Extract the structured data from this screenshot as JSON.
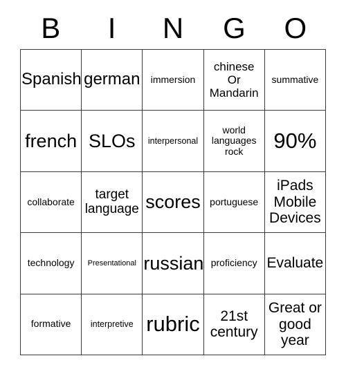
{
  "header": {
    "letters": [
      "B",
      "I",
      "N",
      "G",
      "O"
    ]
  },
  "grid": {
    "rows": 5,
    "columns": 5,
    "border_color": "#3a3a3a",
    "background_color": "#ffffff",
    "text_color": "#000000",
    "cells": [
      {
        "text": "Spanish",
        "size": "fs-xl"
      },
      {
        "text": "german",
        "size": "fs-xl"
      },
      {
        "text": "immersion",
        "size": "fs-sm"
      },
      {
        "text": "chinese\nOr\nMandarin",
        "size": "fs-m"
      },
      {
        "text": "summative",
        "size": "fs-sm"
      },
      {
        "text": "french",
        "size": "fs-xxl"
      },
      {
        "text": "SLOs",
        "size": "fs-xxl"
      },
      {
        "text": "interpersonal",
        "size": "fs-s"
      },
      {
        "text": "world\nlanguages\nrock",
        "size": "fs-sm"
      },
      {
        "text": "90%",
        "size": "fs-huge"
      },
      {
        "text": "collaborate",
        "size": "fs-sm"
      },
      {
        "text": "target\nlanguage",
        "size": "fs-ml"
      },
      {
        "text": "scores",
        "size": "fs-xxl"
      },
      {
        "text": "portuguese",
        "size": "fs-sm"
      },
      {
        "text": "iPads\nMobile\nDevices",
        "size": "fs-l"
      },
      {
        "text": "technology",
        "size": "fs-sm"
      },
      {
        "text": "Presentational",
        "size": "fs-xs"
      },
      {
        "text": "russian",
        "size": "fs-xxl"
      },
      {
        "text": "proficiency",
        "size": "fs-sm"
      },
      {
        "text": "Evaluate",
        "size": "fs-l"
      },
      {
        "text": "formative",
        "size": "fs-sm"
      },
      {
        "text": "interpretive",
        "size": "fs-s"
      },
      {
        "text": "rubric",
        "size": "fs-huge"
      },
      {
        "text": "21st\ncentury",
        "size": "fs-l"
      },
      {
        "text": "Great or\ngood\nyear",
        "size": "fs-l"
      }
    ]
  }
}
